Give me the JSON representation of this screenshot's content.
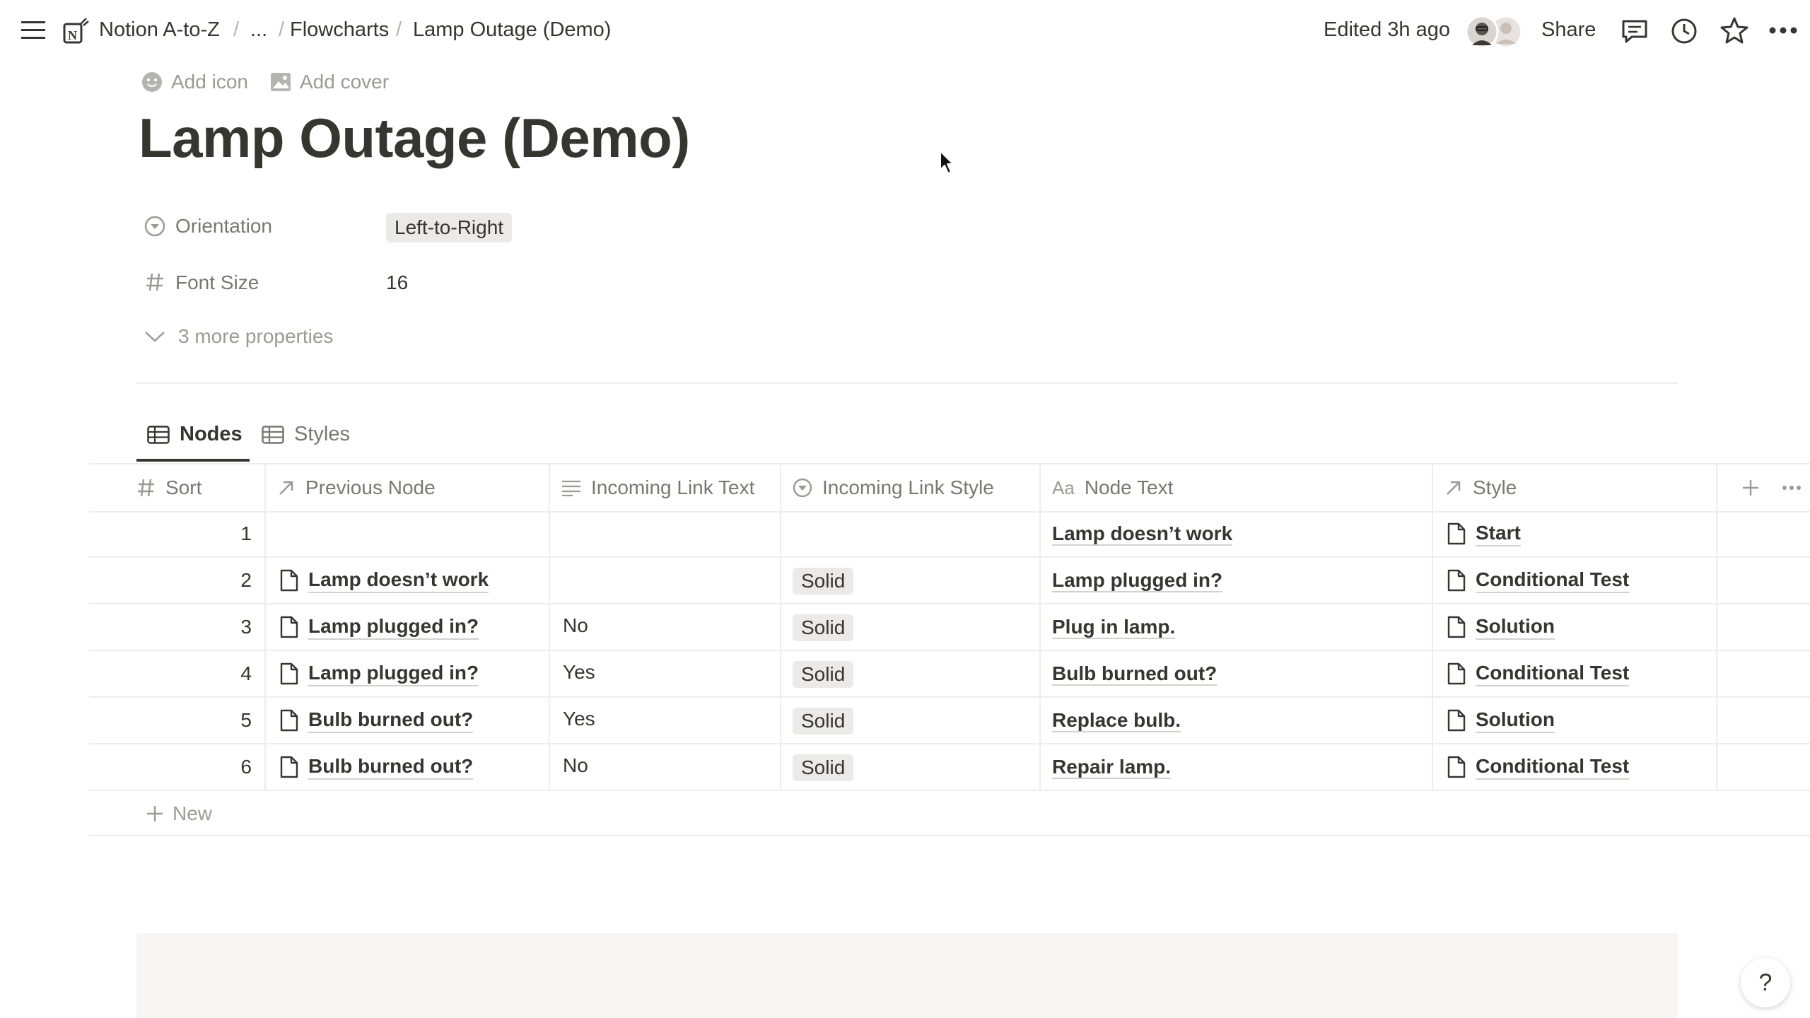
{
  "breadcrumb": {
    "workspace": "Notion A-to-Z",
    "ellipsis": "...",
    "parent": "Flowcharts",
    "current": "Lamp Outage (Demo)"
  },
  "topbar": {
    "edited": "Edited 3h ago",
    "share": "Share"
  },
  "page": {
    "add_icon": "Add icon",
    "add_cover": "Add cover",
    "title": "Lamp Outage (Demo)"
  },
  "properties": {
    "orientation": {
      "label": "Orientation",
      "value": "Left-to-Right"
    },
    "font_size": {
      "label": "Font Size",
      "value": "16"
    },
    "more": "3 more properties"
  },
  "views": {
    "tabs": [
      {
        "label": "Nodes",
        "active": true
      },
      {
        "label": "Styles",
        "active": false
      }
    ]
  },
  "table": {
    "columns": [
      "Sort",
      "Previous Node",
      "Incoming Link Text",
      "Incoming Link Style",
      "Node Text",
      "Style"
    ],
    "rows": [
      {
        "sort": "1",
        "previous": "",
        "link_text": "",
        "link_style": "",
        "node_text": "Lamp doesn’t work",
        "style": "Start"
      },
      {
        "sort": "2",
        "previous": "Lamp doesn’t work",
        "link_text": "",
        "link_style": "Solid",
        "node_text": "Lamp plugged in?",
        "style": "Conditional Test"
      },
      {
        "sort": "3",
        "previous": "Lamp plugged in?",
        "link_text": "No",
        "link_style": "Solid",
        "node_text": "Plug in lamp.",
        "style": "Solution"
      },
      {
        "sort": "4",
        "previous": "Lamp plugged in?",
        "link_text": "Yes",
        "link_style": "Solid",
        "node_text": "Bulb burned out?",
        "style": "Conditional Test"
      },
      {
        "sort": "5",
        "previous": "Bulb burned out?",
        "link_text": "Yes",
        "link_style": "Solid",
        "node_text": "Replace bulb.",
        "style": "Solution"
      },
      {
        "sort": "6",
        "previous": "Bulb burned out?",
        "link_text": "No",
        "link_style": "Solid",
        "node_text": "Repair lamp.",
        "style": "Conditional Test"
      }
    ],
    "new_label": "New"
  },
  "help": "?"
}
